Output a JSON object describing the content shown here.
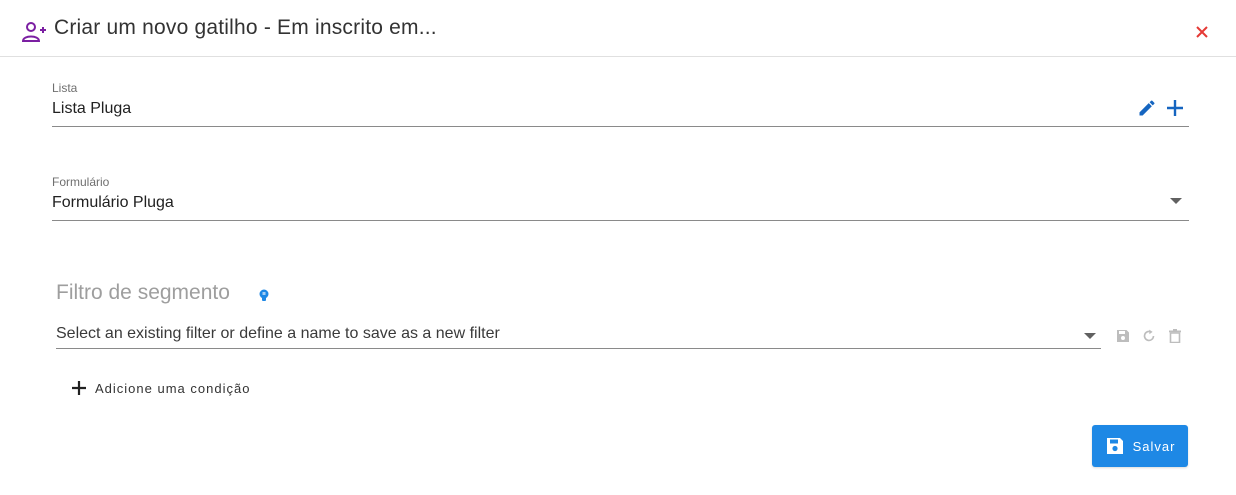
{
  "header": {
    "title": "Criar um novo gatilho - Em inscrito em...",
    "title_icon": "person-add-icon",
    "close_icon": "close-icon"
  },
  "lista_field": {
    "label": "Lista",
    "value": "Lista Pluga",
    "edit_icon": "pencil-icon",
    "add_icon": "plus-icon"
  },
  "formulario_field": {
    "label": "Formulário",
    "value": "Formulário Pluga",
    "dropdown_icon": "chevron-down-icon"
  },
  "segment_filter": {
    "title": "Filtro de segmento",
    "help_icon": "lightbulb-icon",
    "placeholder": "Select an existing filter or define a name to save as a new filter",
    "dropdown_icon": "chevron-down-icon",
    "save_icon": "save-icon",
    "reset_icon": "refresh-icon",
    "delete_icon": "trash-icon",
    "add_condition_label": "Adicione uma condição"
  },
  "footer": {
    "save_label": "Salvar"
  },
  "colors": {
    "accent": "#1e88e5",
    "title_icon": "#7b1fa2",
    "close_icon": "#e53935",
    "action_icon": "#1565c0",
    "muted_icon": "#bdbdbd",
    "bulb": "#1e88e5"
  }
}
